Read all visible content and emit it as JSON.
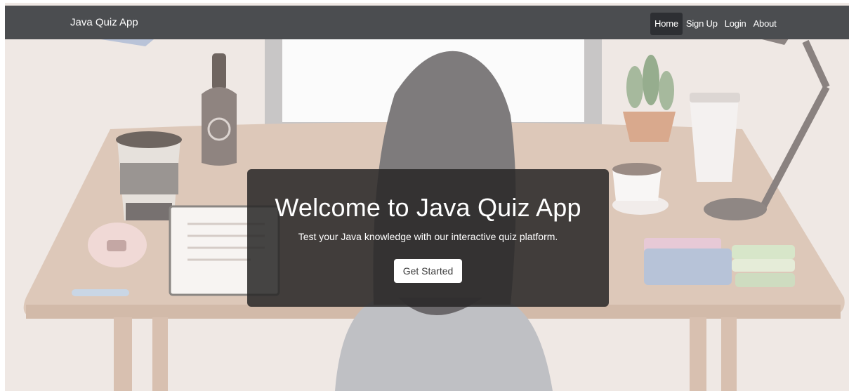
{
  "navbar": {
    "brand": "Java Quiz App",
    "links": [
      {
        "label": "Home",
        "active": true
      },
      {
        "label": "Sign Up",
        "active": false
      },
      {
        "label": "Login",
        "active": false
      },
      {
        "label": "About",
        "active": false
      }
    ]
  },
  "hero": {
    "title": "Welcome to Java Quiz App",
    "subtitle": "Test your Java knowledge with our interactive quiz platform.",
    "cta_label": "Get Started"
  },
  "colors": {
    "navbar_bg": "#4b4d50",
    "active_link_bg": "#2d2f33",
    "card_bg": "#282626",
    "page_bg": "#efe8e4"
  }
}
